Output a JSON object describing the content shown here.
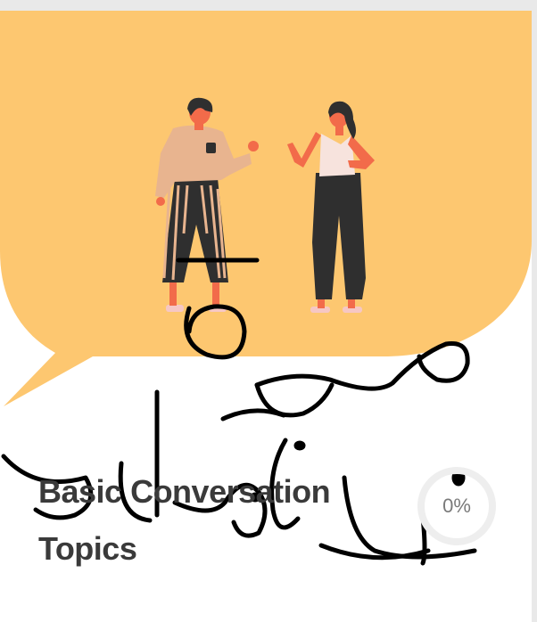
{
  "lesson_card": {
    "title": "Basic Conversation Topics",
    "progress_label": "0%",
    "progress_value": 0,
    "cover_color": "#FDC770",
    "ring_color": "#EEEEEE"
  },
  "handwriting": {
    "text": "صورة غلاف الدرس",
    "color": "#000000"
  }
}
